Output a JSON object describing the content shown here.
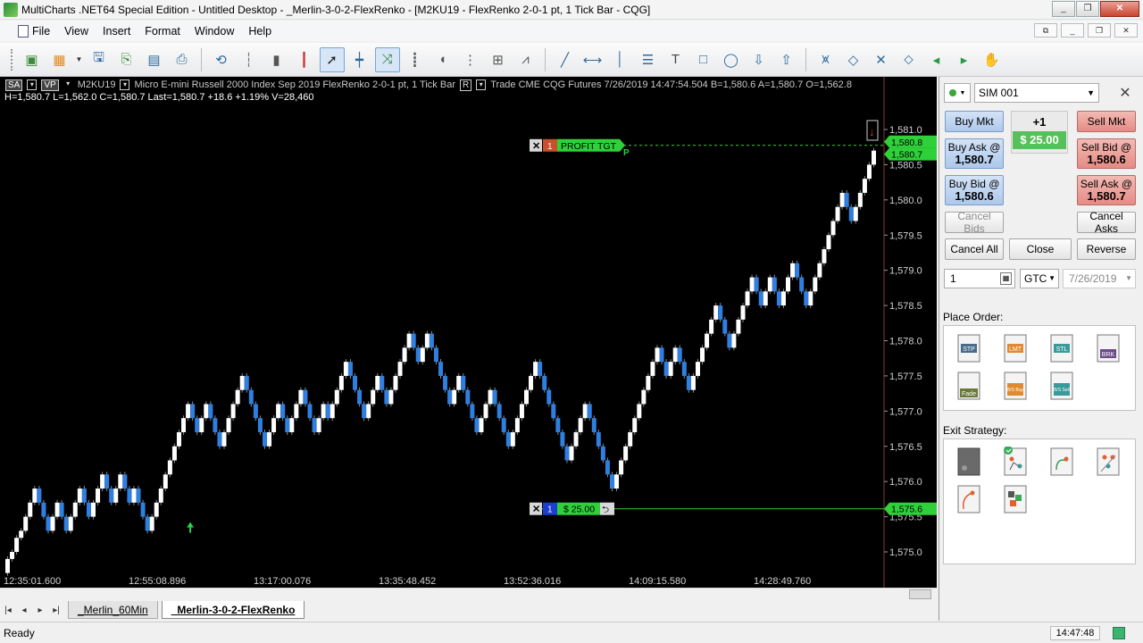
{
  "window": {
    "title": "MultiCharts .NET64 Special Edition - Untitled Desktop - _Merlin-3-0-2-FlexRenko - [M2KU19 - FlexRenko 2-0-1 pt, 1 Tick Bar - CQG]",
    "minimize": "_",
    "restore": "❐",
    "close": "✕"
  },
  "menu": {
    "items": [
      "File",
      "View",
      "Insert",
      "Format",
      "Window",
      "Help"
    ]
  },
  "toolbar": {
    "icons": [
      "new-chart-icon",
      "open-workspace-icon",
      "save-icon",
      "copy-icon",
      "export-image-icon",
      "print-icon",
      "indicator-icon",
      "bar-style-icon",
      "candle-style-icon",
      "ohlc-style-icon",
      "pointer-icon",
      "crosshair-icon",
      "trade-icon",
      "tick-icon",
      "cursor-icon",
      "dots-icon",
      "zoom-icon",
      "fit-icon",
      "line-tool-icon",
      "horizontal-line-icon",
      "vertical-line-icon",
      "fib-icon",
      "text-tool-icon",
      "rectangle-tool-icon",
      "ellipse-tool-icon",
      "arrow-down-tool-icon",
      "arrow-up-tool-icon",
      "zoom-in-x-icon",
      "zoom-out-x-icon",
      "zoom-in-y-icon",
      "zoom-out-y-icon",
      "scroll-left-icon",
      "scroll-right-icon",
      "hand-icon"
    ]
  },
  "chart": {
    "header": {
      "sa": "SA",
      "vp": "VP",
      "symbol": "M2KU19",
      "description": "Micro E-mini Russell 2000 Index Sep 2019  FlexRenko 2-0-1 pt, 1 Tick Bar",
      "r": "R",
      "trade": "Trade  CME  CQG  Futures  7/26/2019  14:47:54.504  B=1,580.6  A=1,580.7  O=1,562.8"
    },
    "ohlc": "H=1,580.7  L=1,562.0  C=1,580.7  Last=1,580.7  +18.6  +1.19%  V=28,460",
    "profit_target_label": "PROFIT TGT",
    "profit_target_qty": "1",
    "profit_marker": "P",
    "position_label": "$ 25.00",
    "position_qty": "1",
    "price_labels": {
      "ask": "1,580.8",
      "last": "1,580.7",
      "entry": "1,575.6"
    }
  },
  "chart_data": {
    "type": "renko",
    "symbol": "M2KU19",
    "y_ticks": [
      "1,581.0",
      "1,580.5",
      "1,580.0",
      "1,579.5",
      "1,579.0",
      "1,578.5",
      "1,578.0",
      "1,577.5",
      "1,577.0",
      "1,576.5",
      "1,576.0",
      "1,575.5",
      "1,575.0"
    ],
    "x_ticks": [
      "12:35:01.600",
      "12:55:08.896",
      "13:17:00.076",
      "13:35:48.452",
      "13:52:36.016",
      "14:09:15.580",
      "14:28:49.760"
    ],
    "ylim": [
      1574.8,
      1581.2
    ],
    "profit_target": 1580.8,
    "entry": 1575.6,
    "closes": [
      1574.9,
      1575.0,
      1575.2,
      1575.3,
      1575.5,
      1575.7,
      1575.9,
      1575.7,
      1575.5,
      1575.3,
      1575.5,
      1575.7,
      1575.5,
      1575.3,
      1575.5,
      1575.7,
      1575.9,
      1575.7,
      1575.5,
      1575.7,
      1575.9,
      1576.1,
      1575.9,
      1575.7,
      1575.9,
      1576.1,
      1575.9,
      1575.7,
      1575.9,
      1575.7,
      1575.5,
      1575.3,
      1575.5,
      1575.7,
      1575.9,
      1576.1,
      1576.3,
      1576.5,
      1576.7,
      1576.9,
      1577.1,
      1576.9,
      1576.7,
      1576.9,
      1577.1,
      1576.9,
      1576.7,
      1576.5,
      1576.7,
      1576.9,
      1577.1,
      1577.3,
      1577.5,
      1577.3,
      1577.1,
      1576.9,
      1576.7,
      1576.5,
      1576.7,
      1576.9,
      1577.1,
      1576.9,
      1576.7,
      1576.9,
      1577.1,
      1577.3,
      1577.1,
      1576.9,
      1576.7,
      1576.9,
      1577.1,
      1576.9,
      1577.1,
      1577.3,
      1577.5,
      1577.7,
      1577.5,
      1577.3,
      1577.1,
      1576.9,
      1577.1,
      1577.3,
      1577.5,
      1577.3,
      1577.1,
      1577.3,
      1577.5,
      1577.7,
      1577.9,
      1578.1,
      1577.9,
      1577.7,
      1577.9,
      1578.1,
      1577.9,
      1577.7,
      1577.5,
      1577.3,
      1577.1,
      1577.3,
      1577.5,
      1577.3,
      1577.1,
      1576.9,
      1576.7,
      1576.9,
      1577.1,
      1577.3,
      1577.1,
      1576.9,
      1576.7,
      1576.5,
      1576.7,
      1576.9,
      1577.1,
      1577.3,
      1577.5,
      1577.7,
      1577.5,
      1577.3,
      1577.1,
      1576.9,
      1576.7,
      1576.5,
      1576.3,
      1576.5,
      1576.7,
      1576.9,
      1577.1,
      1576.9,
      1576.7,
      1576.5,
      1576.3,
      1576.1,
      1575.9,
      1576.1,
      1576.3,
      1576.5,
      1576.7,
      1576.9,
      1577.1,
      1577.3,
      1577.5,
      1577.7,
      1577.9,
      1577.7,
      1577.5,
      1577.7,
      1577.9,
      1577.7,
      1577.5,
      1577.3,
      1577.5,
      1577.7,
      1577.9,
      1578.1,
      1578.3,
      1578.5,
      1578.3,
      1578.1,
      1577.9,
      1578.1,
      1578.3,
      1578.5,
      1578.7,
      1578.9,
      1578.7,
      1578.5,
      1578.7,
      1578.9,
      1578.7,
      1578.5,
      1578.7,
      1578.9,
      1579.1,
      1578.9,
      1578.7,
      1578.5,
      1578.7,
      1578.9,
      1579.1,
      1579.3,
      1579.5,
      1579.7,
      1579.9,
      1580.1,
      1579.9,
      1579.7,
      1579.9,
      1580.1,
      1580.3,
      1580.5,
      1580.7
    ]
  },
  "sheet_tabs": [
    "_Merlin_60Min",
    "_Merlin-3-0-2-FlexRenko"
  ],
  "status": {
    "text": "Ready",
    "clock": "14:47:48"
  },
  "panel": {
    "account": "SIM 001",
    "buy_mkt": "Buy Mkt",
    "sell_mkt": "Sell Mkt",
    "position_qty": "+1",
    "position_pnl": "$ 25.00",
    "buy_ask_label": "Buy Ask @",
    "buy_ask_price": "1,580.7",
    "buy_bid_label": "Buy Bid @",
    "buy_bid_price": "1,580.6",
    "sell_bid_label": "Sell Bid @",
    "sell_bid_price": "1,580.6",
    "sell_ask_label": "Sell Ask @",
    "sell_ask_price": "1,580.7",
    "cancel_bids": "Cancel Bids",
    "cancel_asks": "Cancel Asks",
    "cancel_all": "Cancel All",
    "close": "Close",
    "reverse": "Reverse",
    "quantity": "1",
    "tif": "GTC",
    "date": "7/26/2019",
    "place_order_label": "Place Order:",
    "exit_strategy_label": "Exit Strategy:",
    "order_types": [
      "STP",
      "LMT",
      "STL",
      "BRK",
      "Fade",
      "B/S Buy",
      "B/S Sell"
    ]
  }
}
